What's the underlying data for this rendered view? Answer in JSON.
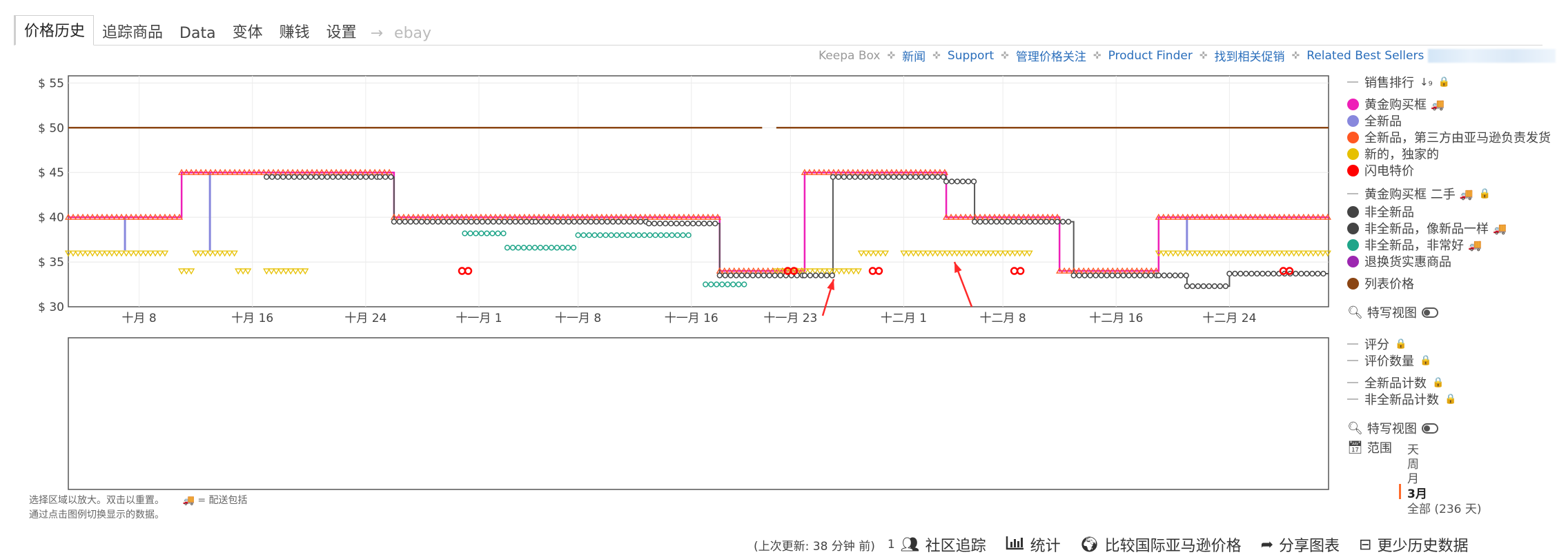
{
  "tabs": [
    {
      "label": "价格历史",
      "active": true
    },
    {
      "label": "追踪商品"
    },
    {
      "label": "Data"
    },
    {
      "label": "变体"
    },
    {
      "label": "赚钱"
    },
    {
      "label": "设置"
    },
    {
      "label": "→"
    },
    {
      "label": "ebay"
    }
  ],
  "toplinks": {
    "keepa_box": "Keepa Box",
    "items": [
      "新闻",
      "Support",
      "管理价格关注",
      "Product Finder",
      "找到相关促销",
      "Related Best Sellers"
    ]
  },
  "legend": {
    "sales_rank": "销售排行",
    "buy_box": "黄金购买框",
    "new": "全新品",
    "new_fba": "全新品，第三方由亚马逊负责发货",
    "new_exclusive": "新的，独家的",
    "lightning": "闪电特价",
    "buy_box_used": "黄金购买框 二手",
    "used": "非全新品",
    "used_like_new": "非全新品，像新品一样",
    "used_very_good": "非全新品，非常好",
    "warehouse": "退换货实惠商品",
    "list_price": "列表价格",
    "close_up": "特写视图",
    "rating": "评分",
    "review_count": "评价数量",
    "new_offer_count": "全新品计数",
    "used_offer_count": "非全新品计数",
    "close_up2": "特写视图",
    "range_label": "范围",
    "range_options": [
      "天",
      "周",
      "月",
      "3月",
      "全部 (236 天)"
    ],
    "range_selected": "3月"
  },
  "colors": {
    "buy_box": "#ee1fb7",
    "new": "#8888dd",
    "new_fba": "#ff5722",
    "new_exclusive": "#e6c000",
    "lightning": "#ff0000",
    "used": "#444444",
    "used_like_new": "#444444",
    "used_very_good": "#1fa589",
    "warehouse": "#9c27b0",
    "list_price": "#8b4513",
    "annotation_arrow": "#ff2a2a"
  },
  "footnote": {
    "line1": "选择区域以放大。双击以重置。",
    "shipping_note": "= 配送包括",
    "line2": "通过点击图例切换显示的数据。"
  },
  "bottom": {
    "last_update": "(上次更新: 38 分钟 前)",
    "community_count": "1",
    "community": "社区追踪",
    "stats": "统计",
    "compare": "比较国际亚马逊价格",
    "share": "分享图表",
    "less_history": "更少历史数据"
  },
  "chart_data": {
    "type": "line",
    "x_ticks": [
      "十月 8",
      "十月 16",
      "十月 24",
      "十一月 1",
      "十一月 8",
      "十一月 16",
      "十一月 23",
      "十二月 1",
      "十二月 8",
      "十二月 16",
      "十二月 24"
    ],
    "y_ticks": [
      "$ 30",
      "$ 35",
      "$ 40",
      "$ 45",
      "$ 50",
      "$ 55"
    ],
    "ylim": [
      30,
      55.8
    ],
    "x_start": "2023-10-03",
    "x_end": "2023-12-31",
    "grid": true,
    "legend_position": "right",
    "series": [
      {
        "name": "列表价格",
        "style": "line",
        "points": [
          [
            "2023-10-03",
            50
          ],
          [
            "2023-11-21",
            50
          ],
          [
            "2023-11-22",
            50
          ],
          [
            "2023-12-31",
            50
          ]
        ]
      },
      {
        "name": "黄金购买框",
        "style": "step",
        "points": [
          [
            "2023-10-03",
            40
          ],
          [
            "2023-10-11",
            45
          ],
          [
            "2023-10-26",
            40
          ],
          [
            "2023-11-18",
            34
          ],
          [
            "2023-11-24",
            45
          ],
          [
            "2023-12-04",
            40
          ],
          [
            "2023-12-12",
            34
          ],
          [
            "2023-12-19",
            40
          ],
          [
            "2023-12-31",
            40
          ]
        ]
      },
      {
        "name": "全新品",
        "style": "line",
        "points": [
          [
            "2023-10-03",
            40
          ],
          [
            "2023-10-11",
            45
          ],
          [
            "2023-10-26",
            40
          ],
          [
            "2023-11-18",
            34
          ],
          [
            "2023-11-24",
            45
          ],
          [
            "2023-12-04",
            40
          ],
          [
            "2023-12-12",
            34
          ],
          [
            "2023-12-19",
            40
          ],
          [
            "2023-12-31",
            40
          ]
        ]
      },
      {
        "name": "全新品，第三方由亚马逊负责发货",
        "style": "triangle",
        "points": [
          [
            "2023-10-03",
            40
          ],
          [
            "2023-10-11",
            45
          ],
          [
            "2023-10-26",
            40
          ],
          [
            "2023-11-18",
            34
          ],
          [
            "2023-11-24",
            45
          ],
          [
            "2023-12-04",
            40
          ],
          [
            "2023-12-12",
            34
          ],
          [
            "2023-12-19",
            40
          ],
          [
            "2023-12-31",
            40
          ]
        ]
      },
      {
        "name": "新的，独家的",
        "style": "triangle-down",
        "points": [
          [
            "2023-10-03",
            36
          ],
          [
            "2023-10-08",
            36
          ],
          [
            "2023-10-12",
            36
          ],
          [
            "2023-10-15",
            36
          ],
          [
            "2023-11-22",
            34
          ],
          [
            "2023-11-28",
            34
          ],
          [
            "2023-12-01",
            36
          ],
          [
            "2023-12-10",
            36
          ],
          [
            "2023-12-19",
            36
          ],
          [
            "2023-12-31",
            36
          ]
        ]
      },
      {
        "name": "非全新品",
        "style": "step",
        "points": [
          [
            "2023-10-17",
            44.5
          ],
          [
            "2023-10-25",
            44.5
          ],
          [
            "2023-10-26",
            39.5
          ],
          [
            "2023-11-05",
            39.5
          ],
          [
            "2023-11-13",
            39.3
          ],
          [
            "2023-11-18",
            33.5
          ],
          [
            "2023-11-24",
            33.5
          ],
          [
            "2023-11-26",
            44.5
          ],
          [
            "2023-12-04",
            44
          ],
          [
            "2023-12-06",
            39.5
          ],
          [
            "2023-12-13",
            33.5
          ],
          [
            "2023-12-19",
            33.5
          ],
          [
            "2023-12-21",
            32.3
          ],
          [
            "2023-12-24",
            33.7
          ],
          [
            "2023-12-31",
            33.7
          ]
        ]
      },
      {
        "name": "非全新品，非常好",
        "style": "circle",
        "points": [
          [
            "2023-10-31",
            38.2
          ],
          [
            "2023-11-03",
            36.6
          ],
          [
            "2023-11-08",
            38
          ],
          [
            "2023-11-17",
            32.5
          ],
          [
            "2023-11-20",
            32.5
          ]
        ]
      },
      {
        "name": "闪电特价",
        "style": "circle",
        "points": [
          [
            "2023-10-31",
            34
          ],
          [
            "2023-11-23",
            34
          ],
          [
            "2023-11-29",
            34
          ],
          [
            "2023-12-09",
            34
          ],
          [
            "2023-12-28",
            34
          ]
        ]
      }
    ]
  }
}
